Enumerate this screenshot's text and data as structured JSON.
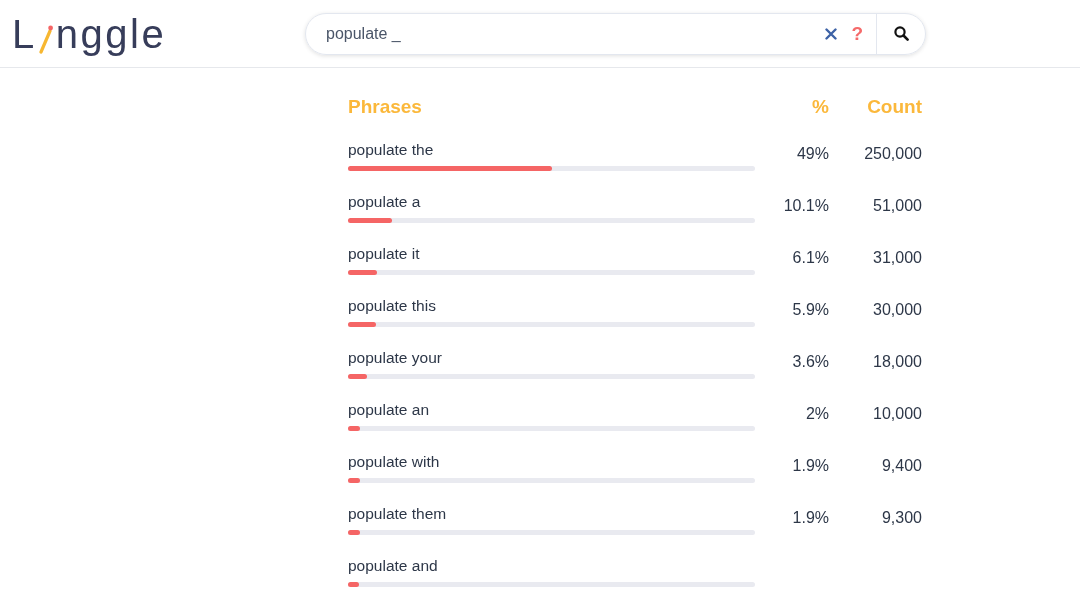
{
  "logo": {
    "text_before": "L",
    "text_after": "nggle"
  },
  "search": {
    "value": "populate _",
    "help_label": "?"
  },
  "table": {
    "columns": [
      "Phrases",
      "%",
      "Count"
    ],
    "rows": [
      {
        "phrase": "populate the",
        "level": 0.5,
        "percent": "49%",
        "count": "250,000"
      },
      {
        "phrase": "populate a",
        "level": 0.108,
        "percent": "10.1%",
        "count": "51,000"
      },
      {
        "phrase": "populate it",
        "level": 0.071,
        "percent": "6.1%",
        "count": "31,000"
      },
      {
        "phrase": "populate this",
        "level": 0.069,
        "percent": "5.9%",
        "count": "30,000"
      },
      {
        "phrase": "populate your",
        "level": 0.047,
        "percent": "3.6%",
        "count": "18,000"
      },
      {
        "phrase": "populate an",
        "level": 0.03,
        "percent": "2%",
        "count": "10,000"
      },
      {
        "phrase": "populate with",
        "level": 0.03,
        "percent": "1.9%",
        "count": "9,400"
      },
      {
        "phrase": "populate them",
        "level": 0.03,
        "percent": "1.9%",
        "count": "9,300"
      },
      {
        "phrase": "populate and",
        "level": 0.027
      }
    ]
  }
}
